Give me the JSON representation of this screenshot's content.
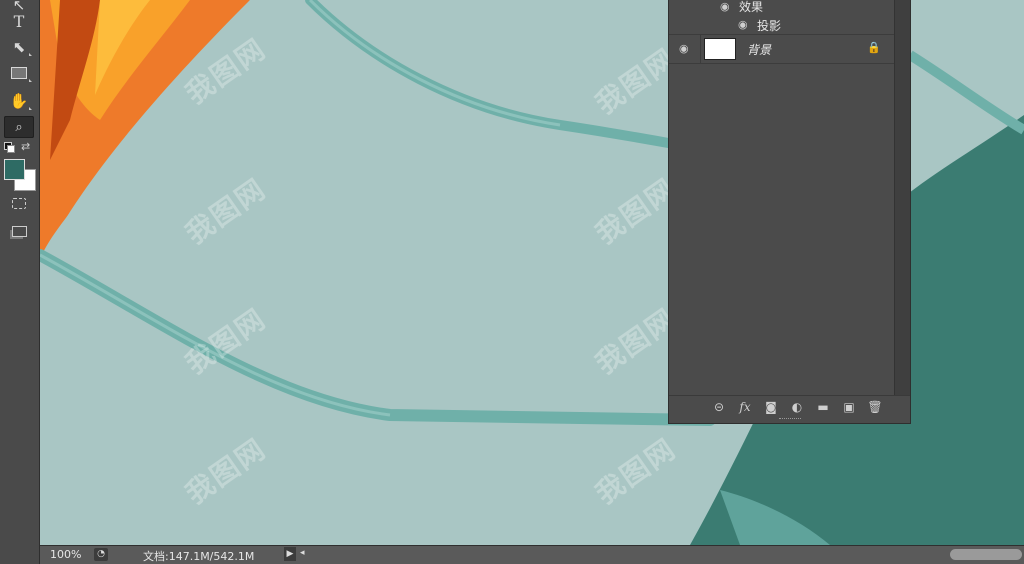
{
  "toolbar": {
    "tools": [
      {
        "name": "move-tool",
        "glyph": "✥"
      },
      {
        "name": "type-tool",
        "glyph": "T"
      },
      {
        "name": "path-selection-tool",
        "glyph": "➤"
      },
      {
        "name": "rectangle-tool",
        "glyph": "▭"
      },
      {
        "name": "hand-tool",
        "glyph": "✋"
      },
      {
        "name": "zoom-tool",
        "glyph": "🔍"
      }
    ],
    "foreground_color": "#2e6b64",
    "background_color": "#ffffff"
  },
  "layers": {
    "effects_label": "效果",
    "drop_shadow_label": "投影",
    "background_layer_name": "背景",
    "footer_icons": [
      "link-icon",
      "fx-icon",
      "mask-icon",
      "adjustment-icon",
      "folder-icon",
      "new-layer-icon",
      "trash-icon"
    ],
    "fx_label": "fx"
  },
  "status": {
    "zoom": "100%",
    "doc_info": "文档:147.1M/542.1M"
  },
  "watermark": "我图网",
  "colors": {
    "canvas_bg": "#a9c6c4",
    "stroke": "#6fb0a9",
    "dark_teal": "#3b7c72",
    "orange": "#f08a32"
  }
}
